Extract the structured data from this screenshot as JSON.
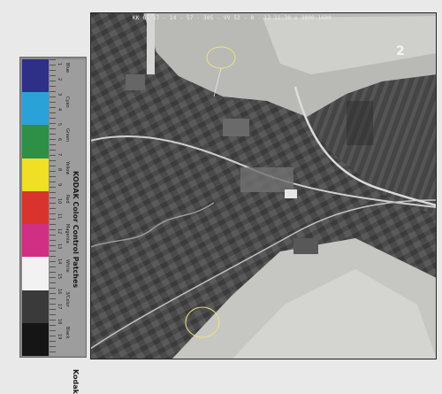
{
  "photo": {
    "caption": "KK 65 17 - 14 - 57 - 305 - VV  52 - 8 - 12  11:30  x  3000-1600",
    "frame_number": "2"
  },
  "kodak_strip": {
    "brand_title": "KODAK Color Control Patches",
    "logo_text": "Kodak",
    "patch_labels": [
      "Blue",
      "Cyan",
      "Green",
      "Yellow",
      "Red",
      "Magenta",
      "White",
      "3/Color",
      "Black"
    ],
    "patch_colors": [
      "#2e2f87",
      "#2aa2d8",
      "#2f8f46",
      "#f0df25",
      "#d8342d",
      "#d02f83",
      "#f2f2f2",
      "#3a3a3a",
      "#151515"
    ],
    "ruler_ticks": [
      "1",
      "2",
      "3",
      "4",
      "5",
      "6",
      "7",
      "8",
      "9",
      "10",
      "11",
      "12",
      "13",
      "14",
      "15",
      "16",
      "17",
      "18",
      "19"
    ]
  }
}
